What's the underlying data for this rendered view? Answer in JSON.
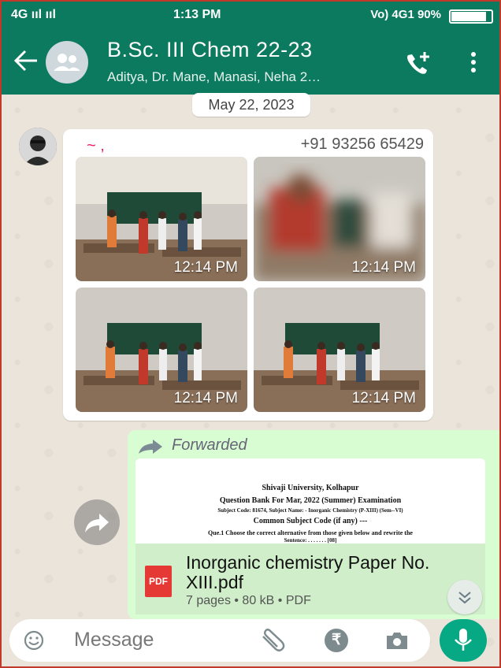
{
  "status_bar": {
    "network_left": "4G ııl  ııl",
    "time": "1:13 PM",
    "network_right": "Vo) 4G1",
    "battery": "90%"
  },
  "header": {
    "group_name": "B.Sc. III Chem 22-23",
    "members": "Aditya, Dr. Mane, Manasi, Neha 2…"
  },
  "chat": {
    "date_chip": "May 22, 2023",
    "incoming": {
      "sender_name": "~ ,",
      "sender_phone": "+91 93256 65429",
      "photos": [
        {
          "time": "12:14 PM"
        },
        {
          "time": "12:14 PM"
        },
        {
          "time": "12:14 PM"
        },
        {
          "time": "12:14 PM"
        }
      ]
    },
    "forwarded": {
      "label": "Forwarded",
      "preview_lines": [
        "Shivaji University, Kolhapur",
        "Question Bank For Mar, 2022 (Summer) Examination",
        "Subject Code: 81674, Subject Name: - Inorganic Chemistry (P-XIII) (Sem--VI)",
        "Common Subject Code (if any) ---",
        "Que.1 Choose the correct alternative from those given below and rewrite the",
        "Sentence:                                         . . . . . . .   [08]"
      ],
      "file_icon": "PDF",
      "file_name": "Inorganic chemistry Paper No. XIII.pdf",
      "file_meta": "7 pages • 80 kB • PDF"
    }
  },
  "composer": {
    "placeholder": "Message",
    "rupee_symbol": "₹"
  },
  "colors": {
    "header": "#0c7a5f",
    "outgoing_bubble": "#d9fdd3",
    "mic_button": "#07a884",
    "sender_name": "#e91e63"
  }
}
